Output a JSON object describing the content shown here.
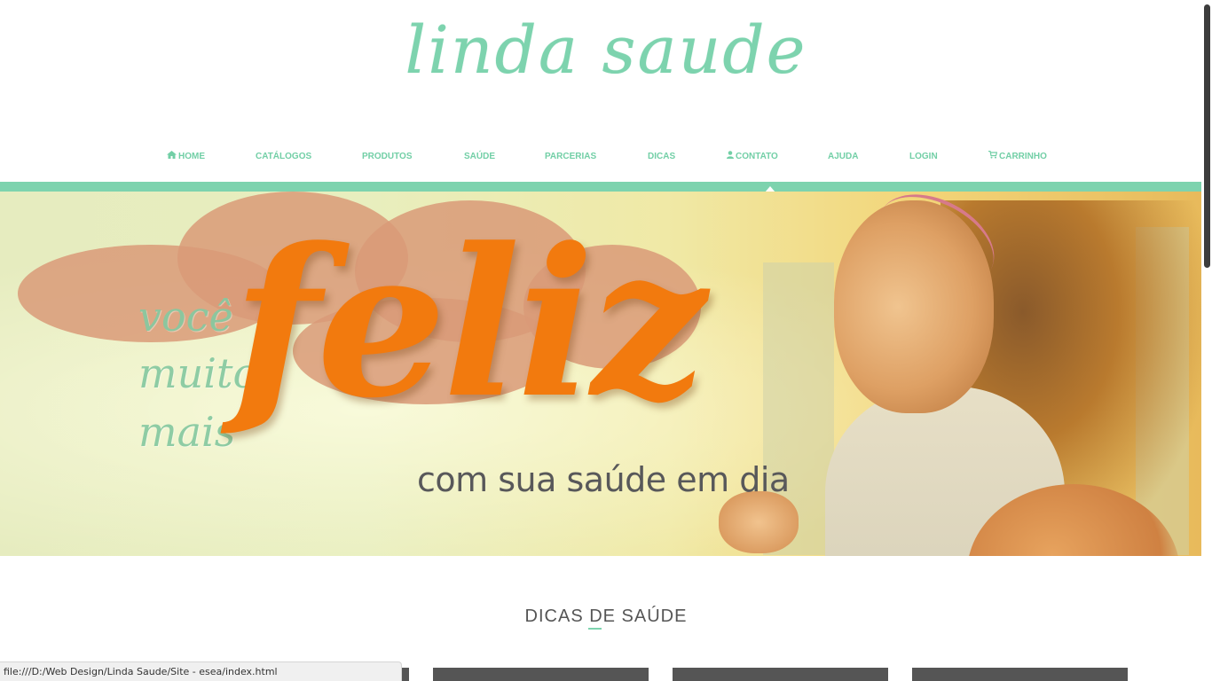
{
  "brand": {
    "logo_text": "linda saude",
    "logo_color": "#7dd3ae"
  },
  "nav": {
    "items": [
      {
        "label": "HOME",
        "icon": "home-icon"
      },
      {
        "label": "CATÁLOGOS"
      },
      {
        "label": "PRODUTOS"
      },
      {
        "label": "SAÚDE"
      },
      {
        "label": "PARCERIAS"
      },
      {
        "label": "DICAS"
      },
      {
        "label": "CONTATO",
        "icon": "user-icon",
        "active": true
      },
      {
        "label": "AJUDA"
      },
      {
        "label": "LOGIN"
      },
      {
        "label": "CARRINHO",
        "icon": "cart-icon"
      }
    ],
    "color": "#72cfa6",
    "bar_color": "#7dd3ae"
  },
  "hero": {
    "line1": "você",
    "line2": "muito",
    "line3": "mais",
    "headline": "feliz",
    "subline": "com sua saúde em dia",
    "headline_color": "#f27a0e",
    "accent_color": "#86c9a1"
  },
  "section": {
    "title": "DICAS DE SAÚDE"
  },
  "statusbar": {
    "url": "file:///D:/Web Design/Linda Saude/Site - esea/index.html"
  }
}
